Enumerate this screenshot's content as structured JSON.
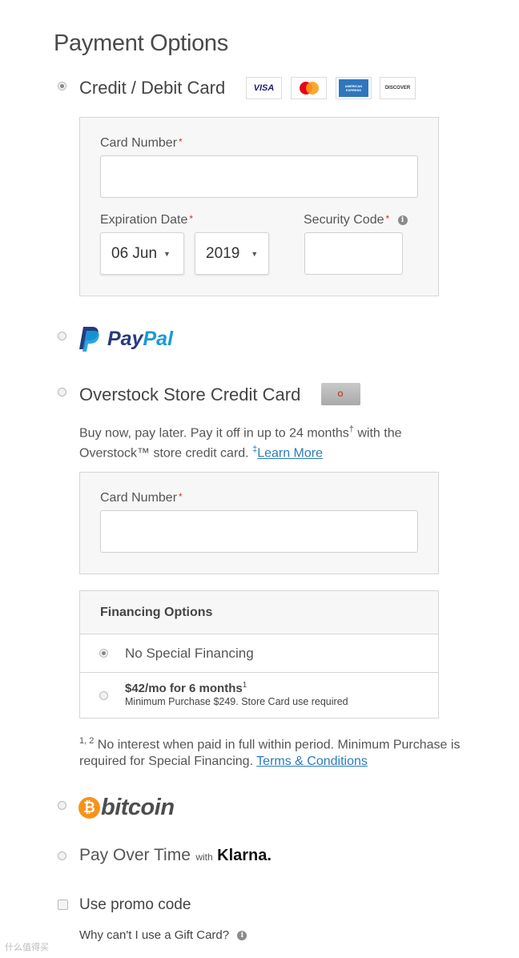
{
  "page": {
    "title": "Payment Options"
  },
  "credit_card": {
    "label": "Credit / Debit Card",
    "selected": true,
    "logos": [
      "VISA",
      "MasterCard",
      "AMERICAN EXPRESS",
      "DISCOVER"
    ],
    "card_number_label": "Card Number",
    "required_mark": "*",
    "expiration_label": "Expiration Date",
    "exp_month": "06 Jun",
    "exp_year": "2019",
    "security_label": "Security Code",
    "info_mark": "i"
  },
  "paypal": {
    "label_pay": "Pay",
    "label_pal": "Pal",
    "selected": false
  },
  "store_card": {
    "label": "Overstock Store Credit Card",
    "card_art_text": "O",
    "description_1": "Buy now, pay later. Pay it off in up to 24 months",
    "dagger": "†",
    "description_2": " with the",
    "description_3": "Overstock™ store credit card. ",
    "double_dagger": "‡",
    "learn_more": "Learn More",
    "card_number_label": "Card Number",
    "financing_title": "Financing Options",
    "financing": [
      {
        "label": "No Special Financing",
        "selected": true
      },
      {
        "label": "$42/mo for 6 months",
        "sup": "1",
        "sub": "Minimum Purchase $249. Store Card use required",
        "selected": false
      }
    ],
    "footnote_marks": "1, 2",
    "footnote_1": " No interest when paid in full within period. Minimum Purchase is",
    "footnote_2": "required for Special Financing. ",
    "terms_link": "Terms & Conditions"
  },
  "bitcoin": {
    "symbol": "₿",
    "label": "bitcoin",
    "selected": false
  },
  "klarna": {
    "label": "Pay Over Time",
    "with": "with",
    "brand": "Klarna.",
    "selected": false
  },
  "promo": {
    "label": "Use promo code",
    "checked": false
  },
  "gift_card": {
    "label": "Why can't I use a Gift Card?",
    "info_mark": "i"
  },
  "watermark": {
    "text": "什么值得买"
  }
}
